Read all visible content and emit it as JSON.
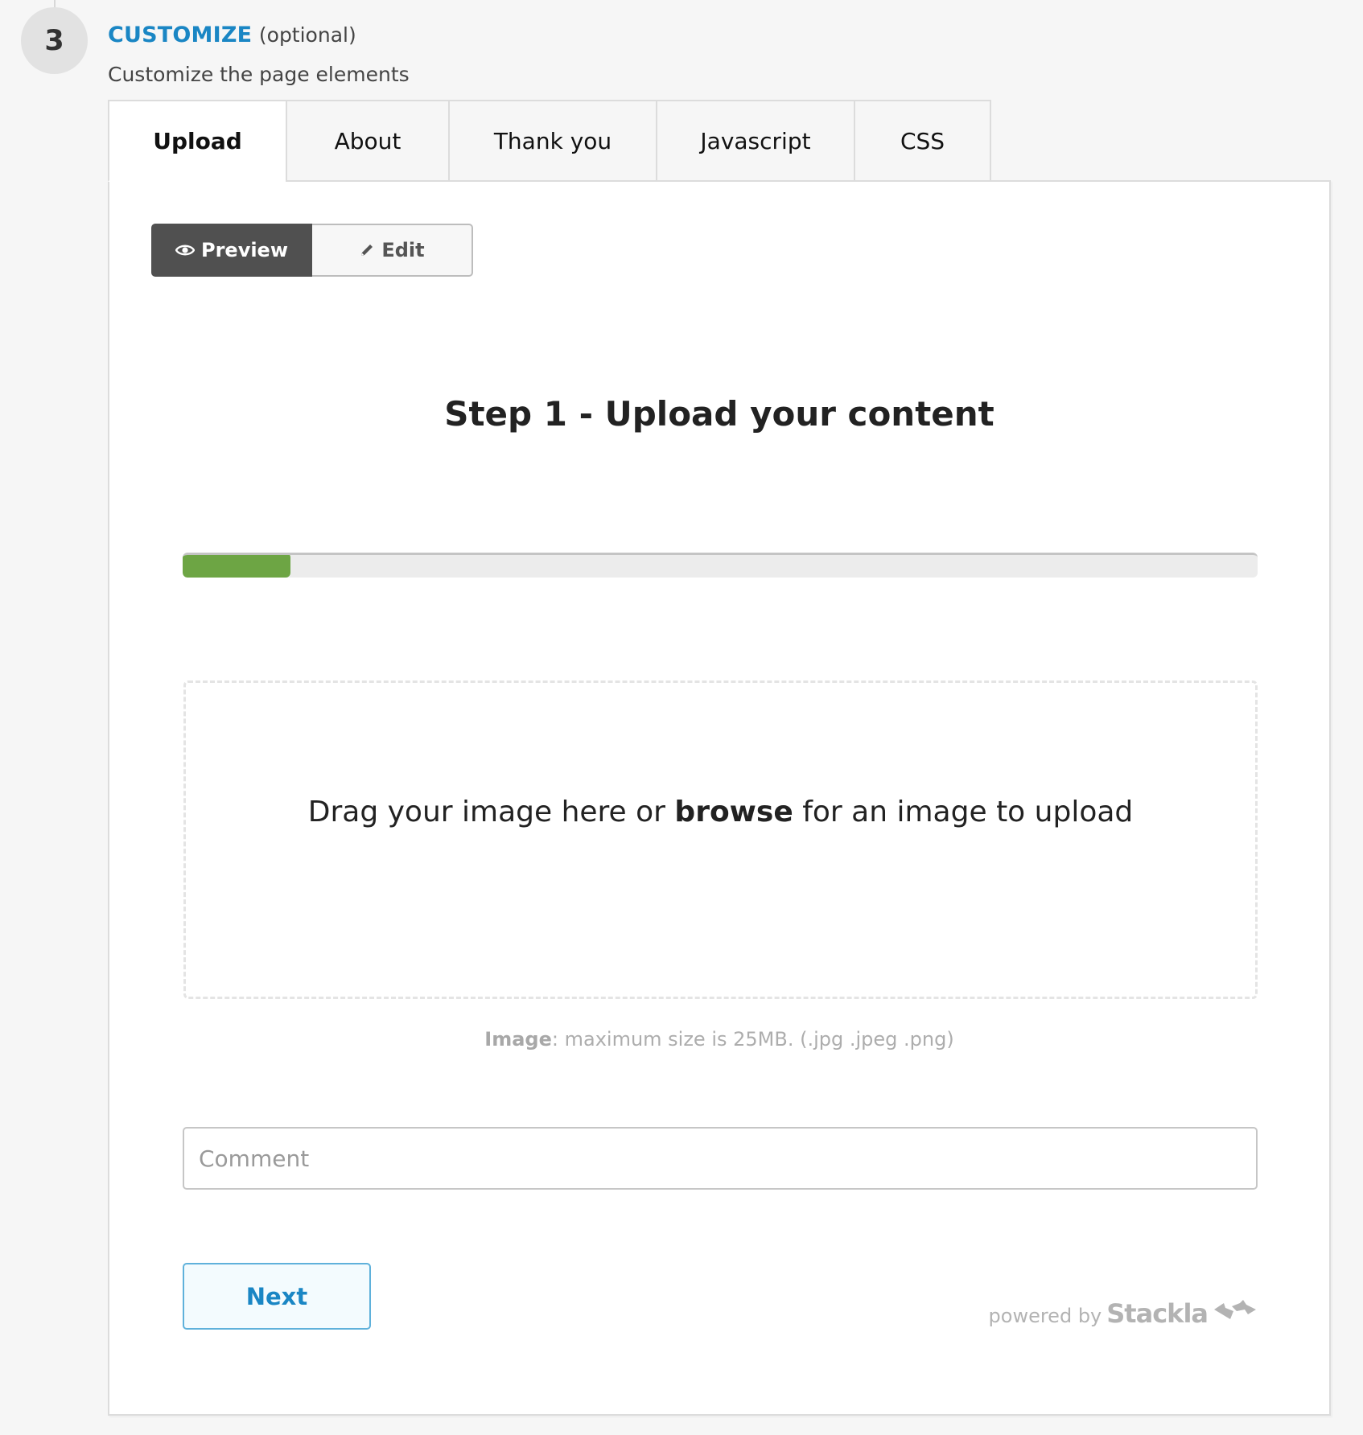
{
  "step": {
    "number": "3",
    "title": "CUSTOMIZE",
    "title_suffix": "(optional)",
    "subtitle": "Customize the page elements",
    "accent_color": "#1a86c4"
  },
  "tabs": [
    {
      "label": "Upload",
      "active": true
    },
    {
      "label": "About",
      "active": false
    },
    {
      "label": "Thank you",
      "active": false
    },
    {
      "label": "Javascript",
      "active": false
    },
    {
      "label": "CSS",
      "active": false
    }
  ],
  "mode_toggle": {
    "preview_label": "Preview",
    "preview_icon": "eye-icon",
    "edit_label": "Edit",
    "edit_icon": "pencil-icon",
    "active": "Preview"
  },
  "upload_form": {
    "heading": "Step 1 - Upload your content",
    "progress_percent": 10,
    "progress_color": "#6da544",
    "dropzone": {
      "text_before": "Drag your image here or ",
      "link": "browse",
      "text_after": " for an image to upload"
    },
    "hint": {
      "label": "Image",
      "text": ": maximum size is 25MB. (.jpg .jpeg .png)"
    },
    "comment": {
      "placeholder": "Comment",
      "value": ""
    },
    "next_label": "Next",
    "powered_by": "powered by",
    "brand": "Stackla",
    "brand_icon": "stackla-logo-icon"
  }
}
